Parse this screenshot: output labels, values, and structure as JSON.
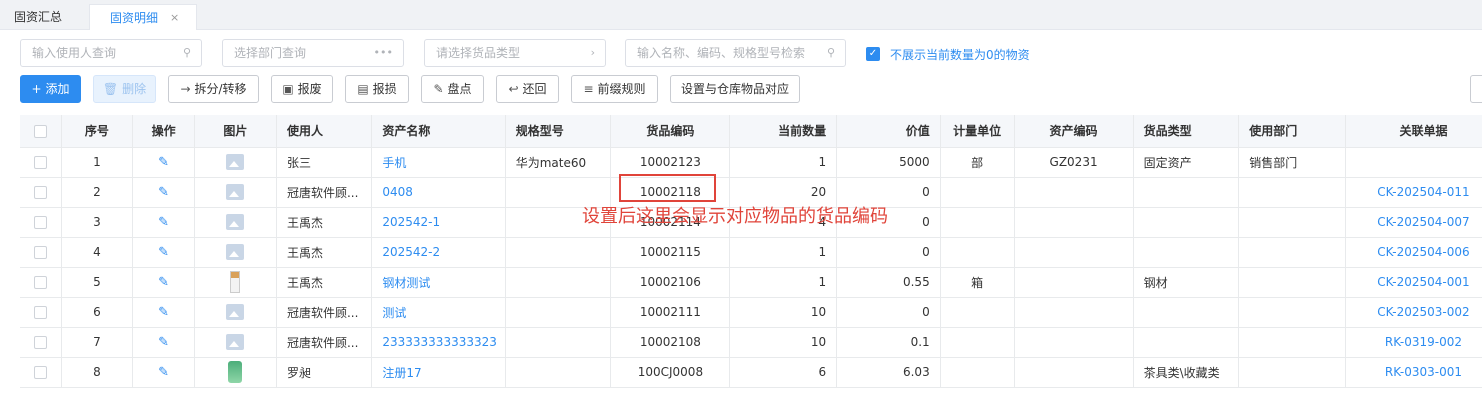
{
  "tabs": [
    {
      "label": "固资汇总"
    },
    {
      "label": "固资明细",
      "close": "×"
    }
  ],
  "filters": {
    "user_placeholder": "输入使用人查询",
    "dept_placeholder": "选择部门查询",
    "goods_type_placeholder": "请选择货品类型",
    "keyword_placeholder": "输入名称、编码、规格型号检索",
    "hide_zero_label": "不展示当前数量为0的物资"
  },
  "toolbar": {
    "add": "添加",
    "delete": "删除",
    "split": "拆分/转移",
    "scrap": "报废",
    "loss": "报损",
    "inventory": "盘点",
    "return": "还回",
    "prefix": "前缀规则",
    "map": "设置与仓库物品对应"
  },
  "columns": [
    "序号",
    "操作",
    "图片",
    "使用人",
    "资产名称",
    "规格型号",
    "货品编码",
    "当前数量",
    "价值",
    "计量单位",
    "资产编码",
    "货品类型",
    "使用部门",
    "关联单据"
  ],
  "rows": [
    {
      "no": "1",
      "img": "placeholder",
      "user": "张三",
      "name": "手机",
      "spec": "华为mate60",
      "code": "10002123",
      "qty": "1",
      "value": "5000",
      "unit": "部",
      "asset_code": "GZ0231",
      "type": "固定资产",
      "dept": "销售部门",
      "doc": ""
    },
    {
      "no": "2",
      "img": "placeholder",
      "user": "冠唐软件顾...",
      "name": "0408",
      "spec": "",
      "code": "10002118",
      "qty": "20",
      "value": "0",
      "unit": "",
      "asset_code": "",
      "type": "",
      "dept": "",
      "doc": "CK-202504-011"
    },
    {
      "no": "3",
      "img": "placeholder",
      "user": "王禹杰",
      "name": "202542-1",
      "spec": "",
      "code": "10002114",
      "qty": "4",
      "value": "0",
      "unit": "",
      "asset_code": "",
      "type": "",
      "dept": "",
      "doc": "CK-202504-007"
    },
    {
      "no": "4",
      "img": "placeholder",
      "user": "王禹杰",
      "name": "202542-2",
      "spec": "",
      "code": "10002115",
      "qty": "1",
      "value": "0",
      "unit": "",
      "asset_code": "",
      "type": "",
      "dept": "",
      "doc": "CK-202504-006"
    },
    {
      "no": "5",
      "img": "bottle",
      "user": "王禹杰",
      "name": "钢材测试",
      "spec": "",
      "code": "10002106",
      "qty": "1",
      "value": "0.55",
      "unit": "箱",
      "asset_code": "",
      "type": "钢材",
      "dept": "",
      "doc": "CK-202504-001"
    },
    {
      "no": "6",
      "img": "placeholder",
      "user": "冠唐软件顾...",
      "name": "测试",
      "spec": "",
      "code": "10002111",
      "qty": "10",
      "value": "0",
      "unit": "",
      "asset_code": "",
      "type": "",
      "dept": "",
      "doc": "CK-202503-002"
    },
    {
      "no": "7",
      "img": "placeholder",
      "user": "冠唐软件顾...",
      "name": "233333333333323",
      "spec": "",
      "code": "10002108",
      "qty": "10",
      "value": "0.1",
      "unit": "",
      "asset_code": "",
      "type": "",
      "dept": "",
      "doc": "RK-0319-002"
    },
    {
      "no": "8",
      "img": "bag",
      "user": "罗昶",
      "name": "注册17",
      "spec": "",
      "code": "100CJ0008",
      "qty": "6",
      "value": "6.03",
      "unit": "",
      "asset_code": "",
      "type": "茶具类\\收藏类",
      "dept": "",
      "doc": "RK-0303-001"
    }
  ],
  "annotation": "设置后这里会显示对应物品的货品编码",
  "colors": {
    "accent": "#2d8cf0",
    "annotation": "#e0443a"
  }
}
